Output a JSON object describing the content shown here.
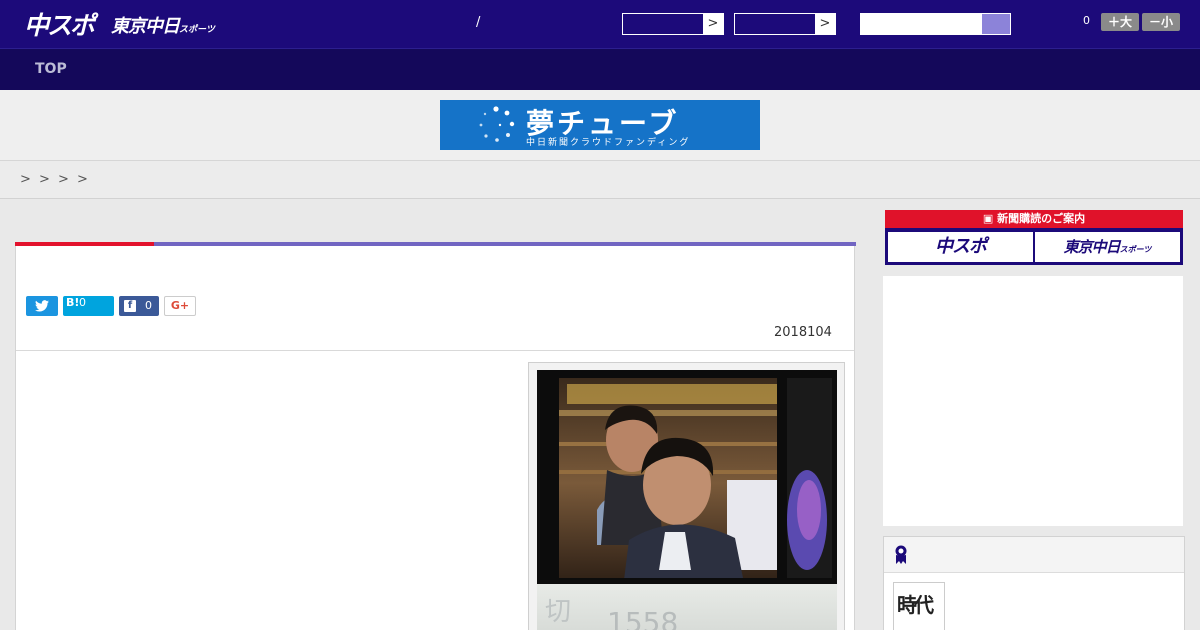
{
  "header": {
    "logo_chuspo": "中スポ",
    "logo_tokyo": "東京中日",
    "logo_tokyo_suffix": "スポーツ",
    "separator": "/",
    "select_arrow": ">",
    "font_count": "0",
    "font_bigger_label": "＋大",
    "font_smaller_label": "－小"
  },
  "nav": {
    "top_label": "TOP"
  },
  "banner_ad": {
    "title": "夢チューブ",
    "subtitle": "中日新聞クラウドファンディング"
  },
  "breadcrumb": {
    "separators": [
      ">",
      ">",
      ">",
      ">"
    ]
  },
  "article": {
    "share": {
      "hatena_mark": "B!",
      "hatena_count": "0",
      "facebook_count": "0",
      "gplus_label": "G+"
    },
    "date": "2018104"
  },
  "sidebar": {
    "subscribe_header": "新聞購読のご案内",
    "subscribe_chuspo": "中スポ",
    "subscribe_tokyo": "東京中日",
    "subscribe_tokyo_suffix": "スポーツ",
    "thumb_text": "時代"
  },
  "colors": {
    "header_bg": "#1c0a7a",
    "nav_bg": "#14085a",
    "accent_red": "#e3122d",
    "accent_purple": "#7165c2",
    "twitter": "#1b95e0",
    "hatena": "#00a4de",
    "facebook": "#3b5998"
  },
  "icons": {
    "twitter": "twitter-bird-icon",
    "hatena": "hatena-bookmark-icon",
    "facebook": "facebook-icon",
    "gplus": "google-plus-icon",
    "ranking": "ranking-medal-icon",
    "search": "search-button-icon"
  }
}
